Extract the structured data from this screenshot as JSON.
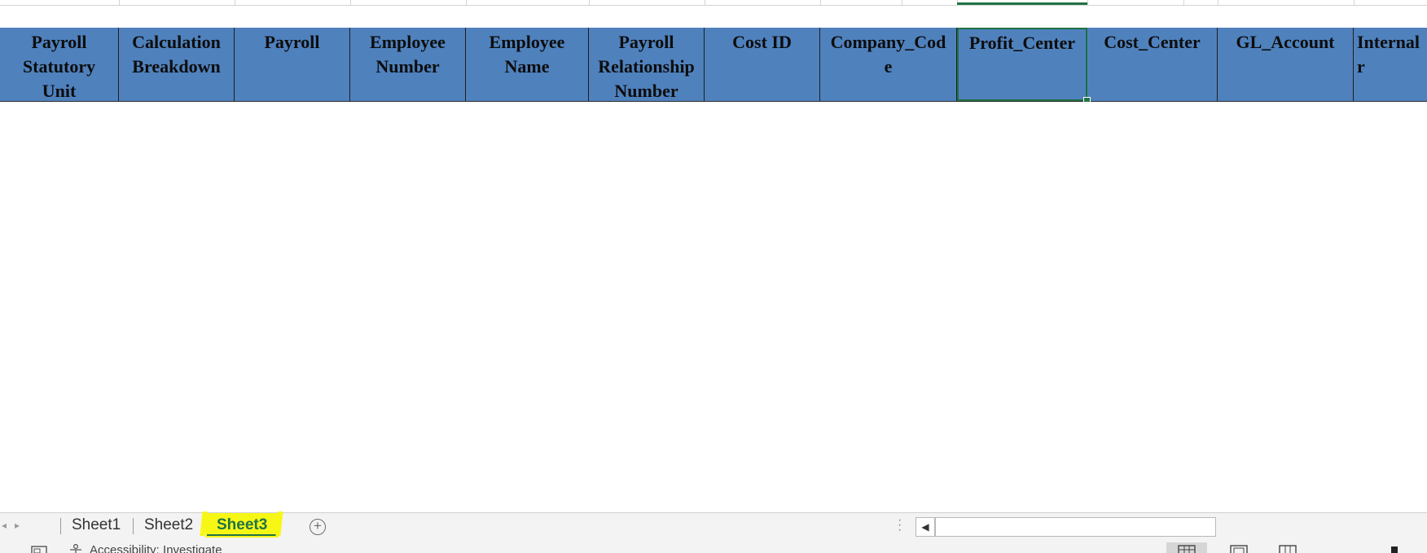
{
  "columns": [
    {
      "label": "Payroll\nStatutory\nUnit"
    },
    {
      "label": "Calculation\nBreakdown"
    },
    {
      "label": "Payroll"
    },
    {
      "label": "Employee\nNumber"
    },
    {
      "label": "Employee\nName"
    },
    {
      "label": "Payroll\nRelationship\nNumber"
    },
    {
      "label": "Cost ID"
    },
    {
      "label": "Company_Cod\ne"
    },
    {
      "label": "Profit_Center",
      "selected": true
    },
    {
      "label": "Cost_Center"
    },
    {
      "label": "GL_Account"
    },
    {
      "label": "Internal\nr"
    }
  ],
  "sheet_tabs": [
    {
      "label": "Sheet1",
      "active": false
    },
    {
      "label": "Sheet2",
      "active": false
    },
    {
      "label": "Sheet3",
      "active": true
    }
  ],
  "status": {
    "accessibility_text": "Accessibility: Investigate"
  },
  "colors": {
    "header_fill": "#4f81bd",
    "selection": "#217346",
    "tab_highlight": "#f7f716"
  }
}
